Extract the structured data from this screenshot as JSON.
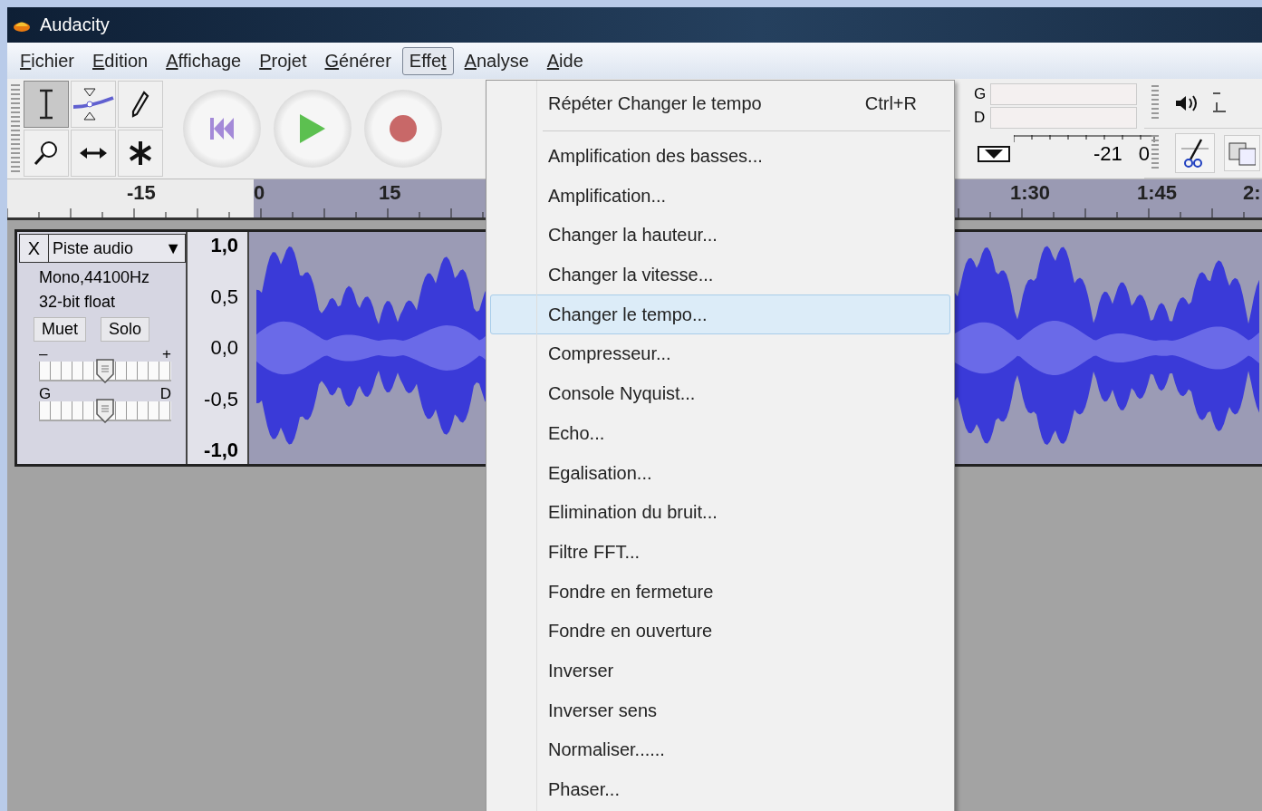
{
  "window": {
    "title": "Audacity"
  },
  "menu_bar": [
    {
      "access_key": "F",
      "after": "ichier",
      "selected": false
    },
    {
      "access_key": "E",
      "after": "dition",
      "selected": false
    },
    {
      "access_key": "A",
      "after": "ffichage",
      "selected": false
    },
    {
      "access_key": "P",
      "after": "rojet",
      "selected": false
    },
    {
      "access_key": "G",
      "after": "énérer",
      "selected": false
    },
    {
      "before": "Effe",
      "access_key": "t",
      "selected": true
    },
    {
      "access_key": "A",
      "after": "nalyse",
      "selected": false
    },
    {
      "access_key": "A",
      "after": "ide",
      "selected": false
    }
  ],
  "tools": [
    {
      "kind": "ibeam",
      "selected": true
    },
    {
      "kind": "envelope",
      "selected": false
    },
    {
      "kind": "pencil",
      "selected": false
    },
    {
      "kind": "zoom",
      "selected": false
    },
    {
      "kind": "timeshift",
      "selected": false
    },
    {
      "kind": "multi",
      "selected": false
    }
  ],
  "transport": [
    {
      "kind": "skip-start"
    },
    {
      "kind": "play"
    },
    {
      "kind": "record"
    }
  ],
  "meter": {
    "channels": [
      "G",
      "D"
    ],
    "scale": [
      "-21",
      "0"
    ]
  },
  "ruler": {
    "labels": [
      "-15",
      "0",
      "15",
      "1:30",
      "1:45",
      "2:"
    ]
  },
  "track": {
    "close": "X",
    "name": "Piste audio",
    "dropdown": "▼",
    "info": [
      "Mono,44100Hz",
      "32-bit float"
    ],
    "buttons": [
      "Muet",
      "Solo"
    ],
    "gain": {
      "min_label": "–",
      "max_label": "+",
      "level": 0.5
    },
    "pan": {
      "min_label": "G",
      "max_label": "D",
      "level": 0.5
    },
    "scale": [
      "1,0",
      "0,5",
      "0,0",
      "-0,5",
      "-1,0"
    ]
  },
  "effect_menu": {
    "items": [
      {
        "kind": "command",
        "label": "Répéter Changer le tempo",
        "shortcut": "Ctrl+R",
        "selected": false
      },
      {
        "kind": "separator"
      },
      {
        "kind": "command",
        "label": "Amplification des basses...",
        "selected": false
      },
      {
        "kind": "command",
        "label": "Amplification...",
        "selected": false
      },
      {
        "kind": "command",
        "label": "Changer la hauteur...",
        "selected": false
      },
      {
        "kind": "command",
        "label": "Changer la vitesse...",
        "selected": false
      },
      {
        "kind": "command",
        "label": "Changer le tempo...",
        "selected": true
      },
      {
        "kind": "command",
        "label": "Compresseur...",
        "selected": false
      },
      {
        "kind": "command",
        "label": "Console Nyquist...",
        "selected": false
      },
      {
        "kind": "command",
        "label": "Echo...",
        "selected": false
      },
      {
        "kind": "command",
        "label": "Egalisation...",
        "selected": false
      },
      {
        "kind": "command",
        "label": "Elimination du bruit...",
        "selected": false
      },
      {
        "kind": "command",
        "label": "Filtre FFT...",
        "selected": false
      },
      {
        "kind": "command",
        "label": "Fondre en fermeture",
        "selected": false
      },
      {
        "kind": "command",
        "label": "Fondre en ouverture",
        "selected": false
      },
      {
        "kind": "command",
        "label": "Inverser",
        "selected": false
      },
      {
        "kind": "command",
        "label": "Inverser sens",
        "selected": false
      },
      {
        "kind": "command",
        "label": "Normaliser......",
        "selected": false
      },
      {
        "kind": "command",
        "label": "Phaser...",
        "selected": false
      }
    ]
  }
}
